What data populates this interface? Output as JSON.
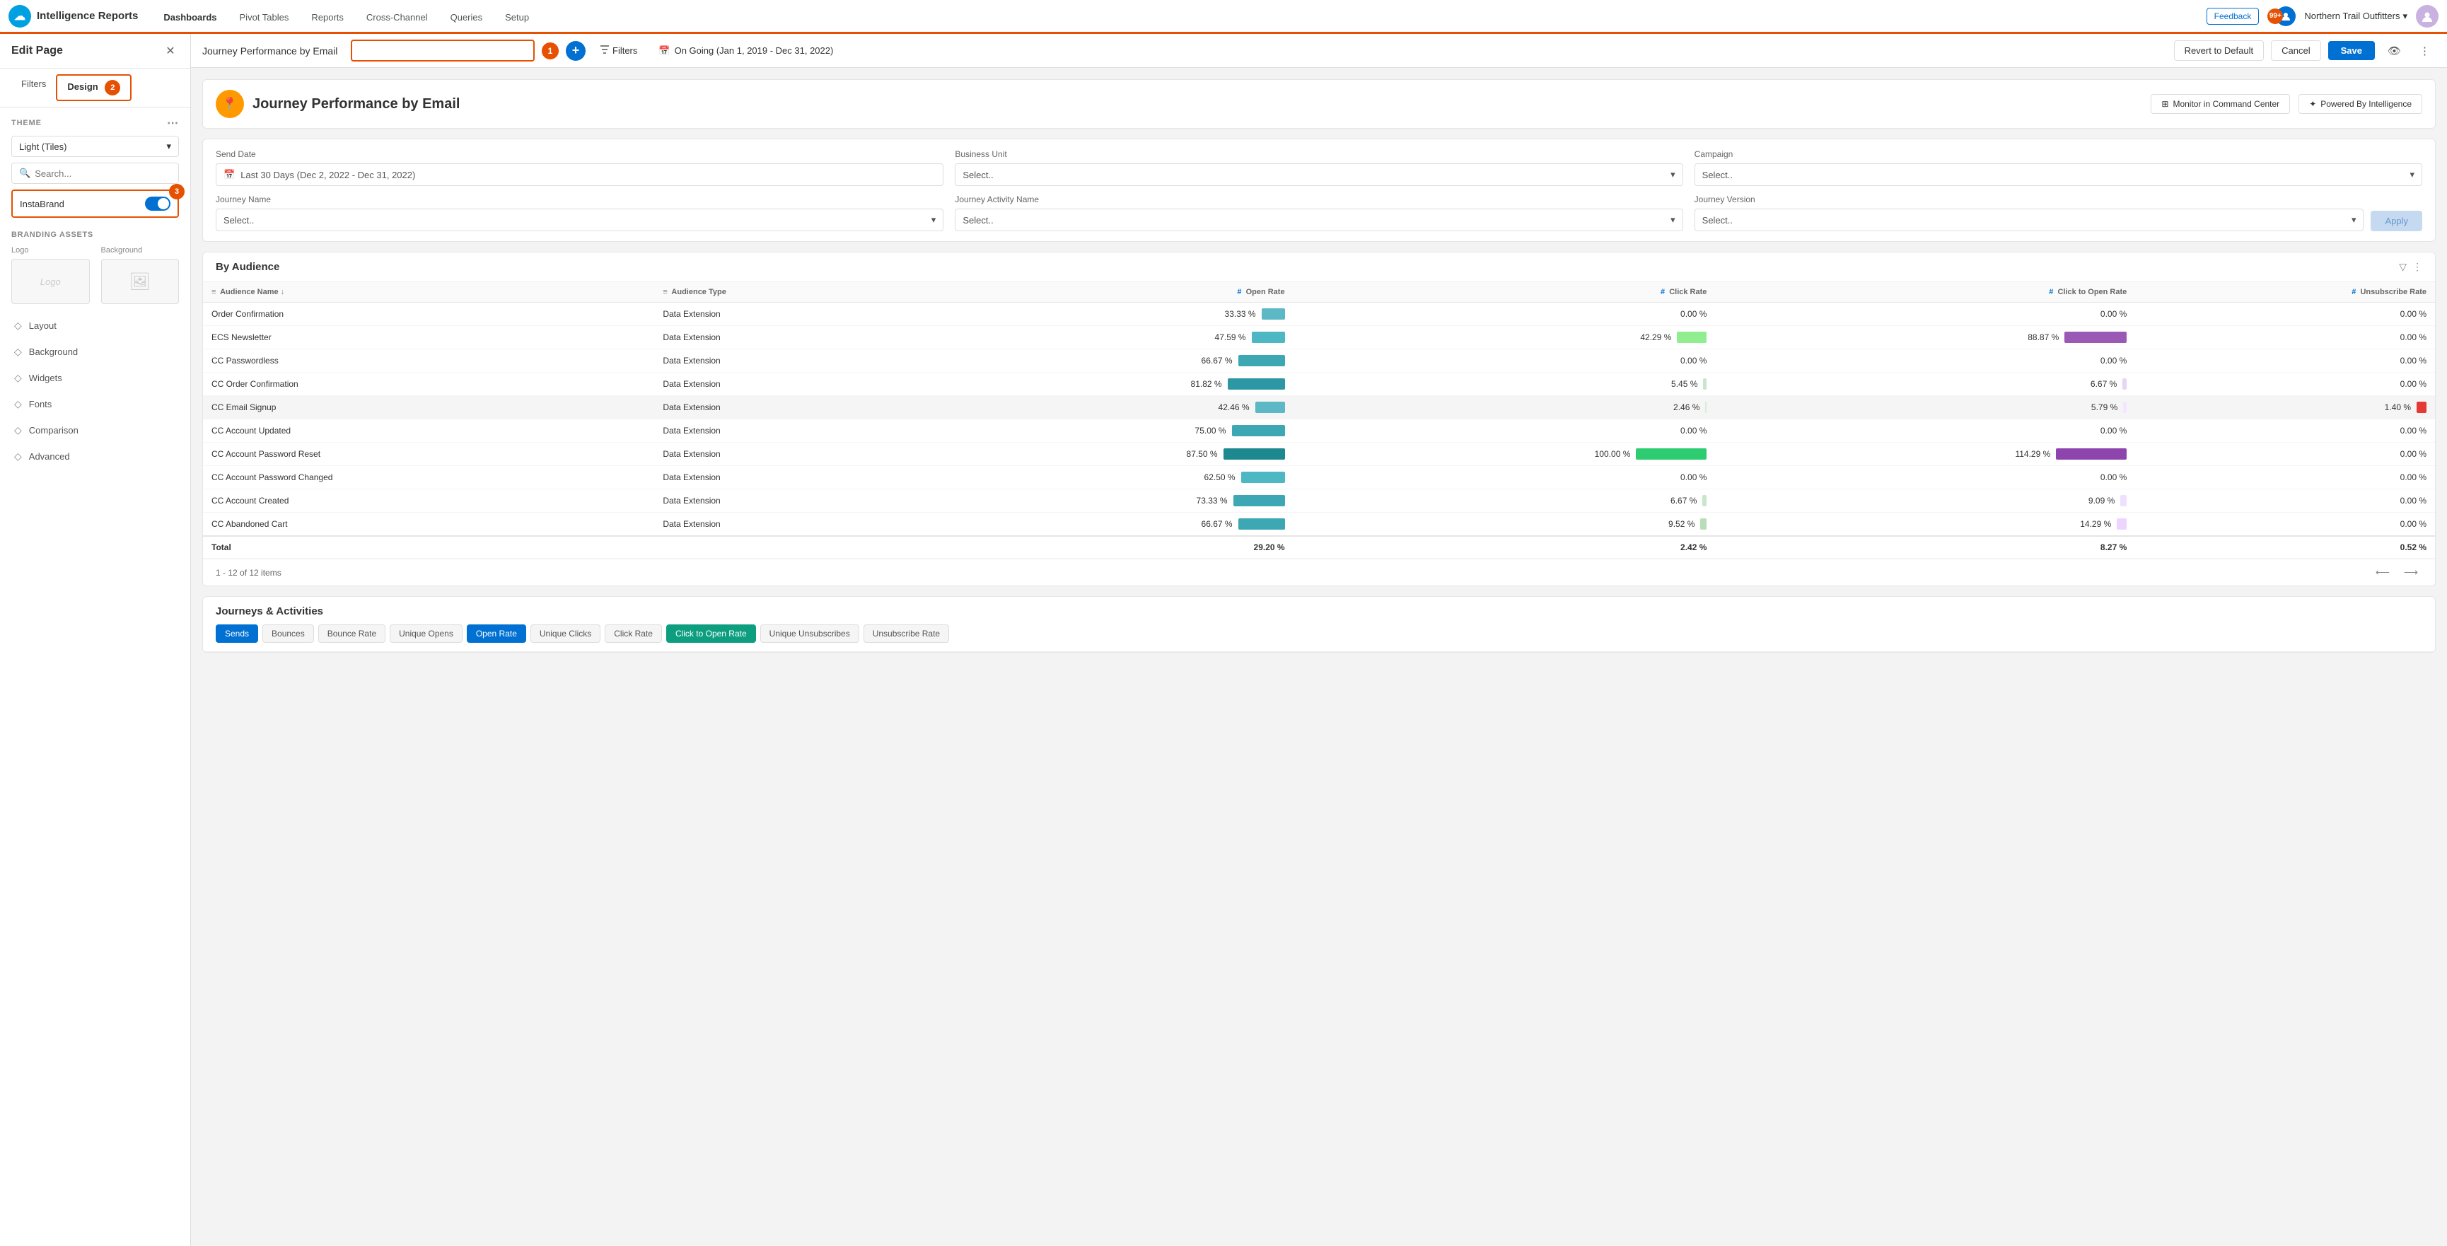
{
  "nav": {
    "logo": "☁",
    "app_name": "Intelligence Reports",
    "tabs": [
      {
        "label": "Dashboards",
        "active": true
      },
      {
        "label": "Pivot Tables",
        "active": false
      },
      {
        "label": "Reports",
        "active": false
      },
      {
        "label": "Cross-Channel",
        "active": false
      },
      {
        "label": "Queries",
        "active": false
      },
      {
        "label": "Setup",
        "active": false
      }
    ],
    "feedback": "Feedback",
    "notif_count": "99+",
    "org_name": "Northern Trail Outfitters",
    "user_initial": "U"
  },
  "sidebar": {
    "title": "Edit Page",
    "tabs": [
      {
        "label": "Filters",
        "active": false
      },
      {
        "label": "Design",
        "active": true
      }
    ],
    "tab_badge": "2",
    "theme_label": "THEME",
    "theme_value": "Light (Tiles)",
    "search_placeholder": "Search...",
    "instabrand_label": "InstaBrand",
    "instabrand_badge": "3",
    "branding_label": "Branding Assets",
    "logo_label": "Logo",
    "logo_placeholder": "Logo",
    "background_label": "Background",
    "background_placeholder": "🖼",
    "menu_items": [
      {
        "label": "Layout",
        "icon": "◇"
      },
      {
        "label": "Background",
        "icon": "◇"
      },
      {
        "label": "Widgets",
        "icon": "◇"
      },
      {
        "label": "Fonts",
        "icon": "◇"
      },
      {
        "label": "Comparison",
        "icon": "◇"
      },
      {
        "label": "Advanced",
        "icon": "◇"
      }
    ]
  },
  "toolbar": {
    "page_name_label": "Journey Performance by Email",
    "input_placeholder": "",
    "step1_badge": "1",
    "add_label": "+",
    "filter_label": "Filters",
    "date_label": "On Going (Jan 1, 2019 - Dec 31, 2022)",
    "revert_label": "Revert to Default",
    "cancel_label": "Cancel",
    "save_label": "Save"
  },
  "dashboard": {
    "icon": "📍",
    "title": "Journey Performance by Email",
    "monitor_label": "Monitor in Command Center",
    "powered_label": "Powered By Intelligence",
    "filters": {
      "send_date_label": "Send Date",
      "send_date_value": "Last 30 Days (Dec 2, 2022 - Dec 31, 2022)",
      "business_unit_label": "Business Unit",
      "business_unit_placeholder": "Select..",
      "campaign_label": "Campaign",
      "campaign_placeholder": "Select..",
      "journey_name_label": "Journey Name",
      "journey_name_placeholder": "Select..",
      "journey_activity_label": "Journey Activity Name",
      "journey_activity_placeholder": "Select..",
      "journey_version_label": "Journey Version",
      "journey_version_placeholder": "Select..",
      "apply_label": "Apply"
    },
    "by_audience": {
      "title": "By Audience",
      "columns": [
        {
          "label": "Audience Name",
          "sort": "↓",
          "icon": "≡"
        },
        {
          "label": "Audience Type",
          "icon": "≡"
        },
        {
          "label": "Open Rate",
          "numeric": true,
          "col_icon": "#"
        },
        {
          "label": "Click Rate",
          "numeric": true,
          "col_icon": "#"
        },
        {
          "label": "Click to Open Rate",
          "numeric": true,
          "col_icon": "#"
        },
        {
          "label": "Unsubscribe Rate",
          "numeric": true,
          "col_icon": "#"
        }
      ],
      "rows": [
        {
          "name": "Order Confirmation",
          "type": "Data Extension",
          "open_rate": "33.33 %",
          "open_w": 33,
          "open_color": "#5bb8c4",
          "click_rate": "0.00 %",
          "click_w": 0,
          "click_color": "transparent",
          "cto_rate": "0.00 %",
          "cto_w": 0,
          "cto_color": "transparent",
          "unsub_rate": "0.00 %",
          "highlighted": false
        },
        {
          "name": "ECS Newsletter",
          "type": "Data Extension",
          "open_rate": "47.59 %",
          "open_w": 47,
          "open_color": "#4db8c4",
          "click_rate": "42.29 %",
          "click_w": 42,
          "click_color": "#90ee90",
          "cto_rate": "88.87 %",
          "cto_w": 88,
          "cto_color": "#9b59b6",
          "unsub_rate": "0.00 %",
          "highlighted": false
        },
        {
          "name": "CC Passwordless",
          "type": "Data Extension",
          "open_rate": "66.67 %",
          "open_w": 66,
          "open_color": "#3da8b4",
          "click_rate": "0.00 %",
          "click_w": 0,
          "click_color": "transparent",
          "cto_rate": "0.00 %",
          "cto_w": 0,
          "cto_color": "transparent",
          "unsub_rate": "0.00 %",
          "highlighted": false
        },
        {
          "name": "CC Order Confirmation",
          "type": "Data Extension",
          "open_rate": "81.82 %",
          "open_w": 81,
          "open_color": "#2d98a4",
          "click_rate": "5.45 %",
          "click_w": 5,
          "click_color": "#c8e6c9",
          "cto_rate": "6.67 %",
          "cto_w": 6,
          "cto_color": "#e8d5f5",
          "unsub_rate": "0.00 %",
          "highlighted": false
        },
        {
          "name": "CC Email Signup",
          "type": "Data Extension",
          "open_rate": "42.46 %",
          "open_w": 42,
          "open_color": "#5bb8c4",
          "click_rate": "2.46 %",
          "click_w": 2,
          "click_color": "#d4edda",
          "cto_rate": "5.79 %",
          "cto_w": 5,
          "cto_color": "#f5e6ff",
          "unsub_rate": "1.40 %",
          "unsub_color": "#e53935",
          "unsub_w": 14,
          "highlighted": true
        },
        {
          "name": "CC Account Updated",
          "type": "Data Extension",
          "open_rate": "75.00 %",
          "open_w": 75,
          "open_color": "#3da8b4",
          "click_rate": "0.00 %",
          "click_w": 0,
          "click_color": "transparent",
          "cto_rate": "0.00 %",
          "cto_w": 0,
          "cto_color": "transparent",
          "unsub_rate": "0.00 %",
          "highlighted": false
        },
        {
          "name": "CC Account Password Reset",
          "type": "Data Extension",
          "open_rate": "87.50 %",
          "open_w": 87,
          "open_color": "#1d8890",
          "click_rate": "100.00 %",
          "click_w": 100,
          "click_color": "#2ecc71",
          "cto_rate": "114.29 %",
          "cto_w": 100,
          "cto_color": "#8e44ad",
          "unsub_rate": "0.00 %",
          "highlighted": false
        },
        {
          "name": "CC Account Password Changed",
          "type": "Data Extension",
          "open_rate": "62.50 %",
          "open_w": 62,
          "open_color": "#4db8c4",
          "click_rate": "0.00 %",
          "click_w": 0,
          "click_color": "transparent",
          "cto_rate": "0.00 %",
          "cto_w": 0,
          "cto_color": "transparent",
          "unsub_rate": "0.00 %",
          "highlighted": false
        },
        {
          "name": "CC Account Created",
          "type": "Data Extension",
          "open_rate": "73.33 %",
          "open_w": 73,
          "open_color": "#3da8b4",
          "click_rate": "6.67 %",
          "click_w": 6,
          "click_color": "#c8e6c9",
          "cto_rate": "9.09 %",
          "cto_w": 9,
          "cto_color": "#f0e0ff",
          "unsub_rate": "0.00 %",
          "highlighted": false
        },
        {
          "name": "CC Abandoned Cart",
          "type": "Data Extension",
          "open_rate": "66.67 %",
          "open_w": 66,
          "open_color": "#3da8b4",
          "click_rate": "9.52 %",
          "click_w": 9,
          "click_color": "#b8ddb8",
          "cto_rate": "14.29 %",
          "cto_w": 14,
          "cto_color": "#edd5ff",
          "unsub_rate": "0.00 %",
          "highlighted": false
        }
      ],
      "total_row": {
        "label": "Total",
        "open_rate": "29.20 %",
        "click_rate": "2.42 %",
        "cto_rate": "8.27 %",
        "unsub_rate": "0.52 %"
      },
      "pagination": "1 - 12 of 12 items"
    },
    "journeys": {
      "title": "Journeys & Activities",
      "metric_tabs": [
        {
          "label": "Sends",
          "active": "blue"
        },
        {
          "label": "Bounces",
          "active": "none"
        },
        {
          "label": "Bounce Rate",
          "active": "none"
        },
        {
          "label": "Unique Opens",
          "active": "none"
        },
        {
          "label": "Open Rate",
          "active": "blue"
        },
        {
          "label": "Unique Clicks",
          "active": "none"
        },
        {
          "label": "Click Rate",
          "active": "none"
        },
        {
          "label": "Click to Open Rate",
          "active": "teal"
        },
        {
          "label": "Unique Unsubscribes",
          "active": "none"
        },
        {
          "label": "Unsubscribe Rate",
          "active": "none"
        }
      ]
    }
  }
}
